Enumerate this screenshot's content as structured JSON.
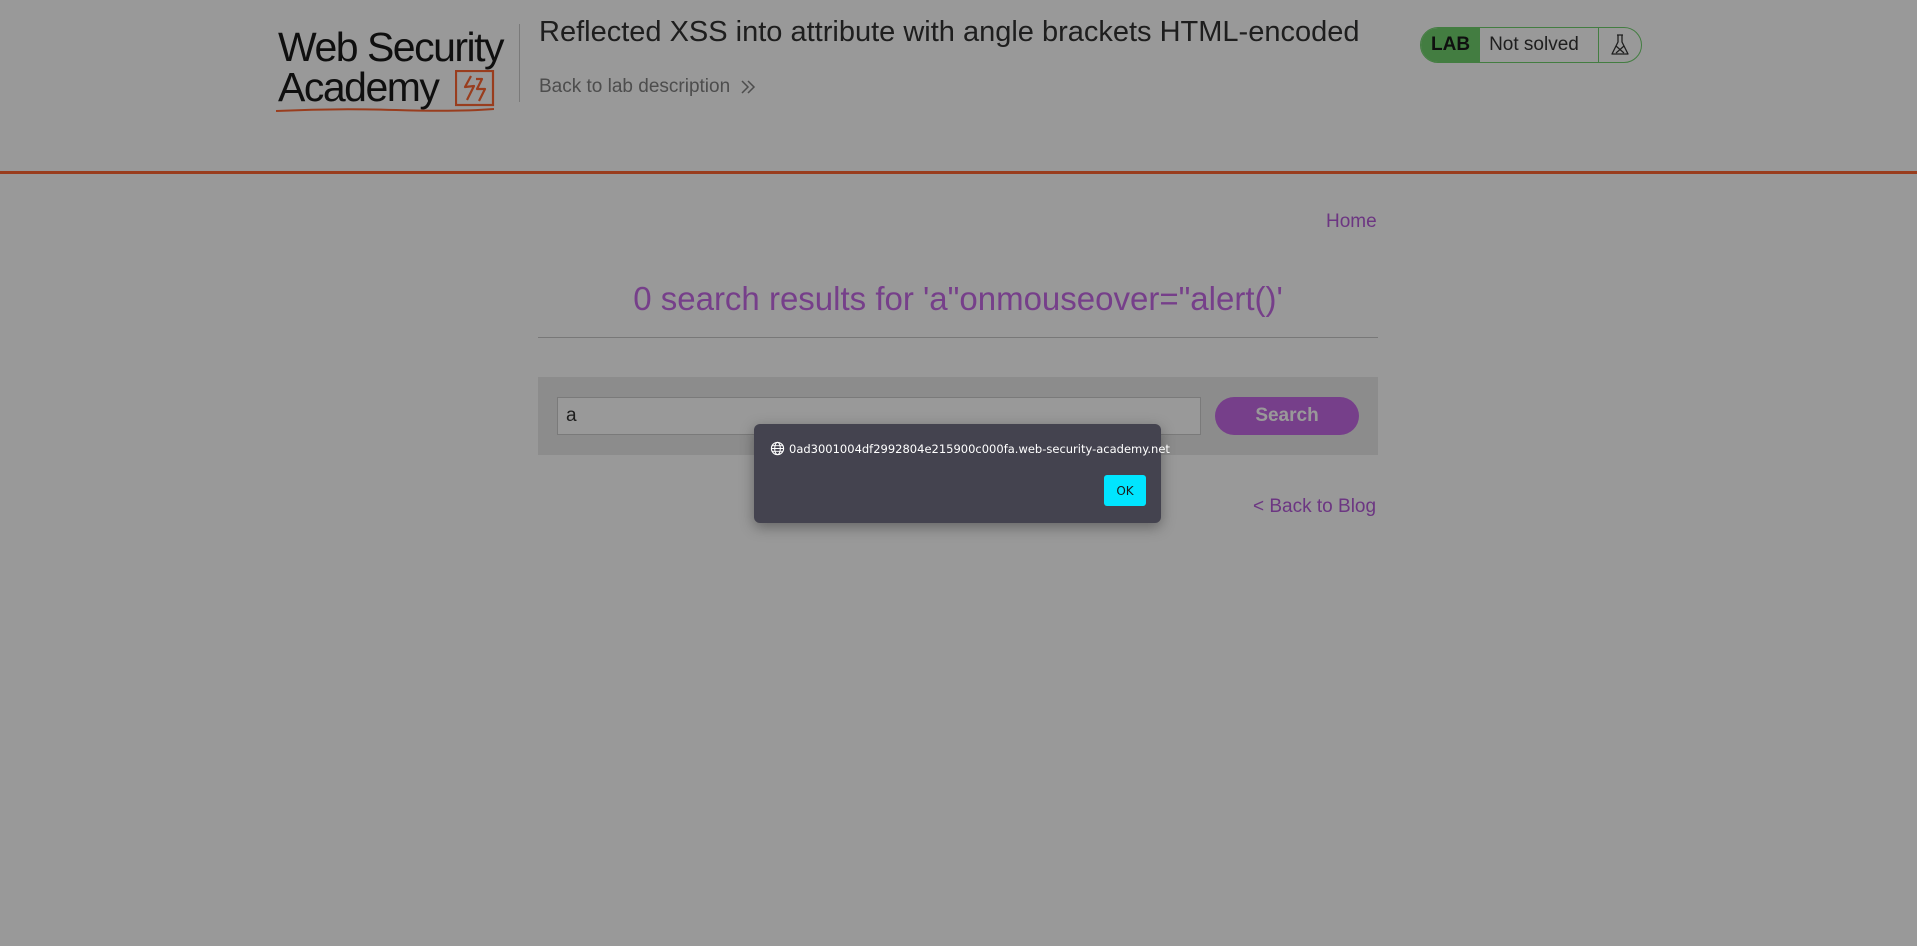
{
  "header": {
    "logo": {
      "line1": "Web Security",
      "line2": "Academy"
    },
    "lab_title": "Reflected XSS into attribute with angle brackets HTML-encoded",
    "back_to_description": "Back to lab description",
    "lab_badge": {
      "label": "LAB",
      "status": "Not solved",
      "icon": "flask-icon"
    }
  },
  "nav": {
    "home": "Home"
  },
  "results": {
    "title": "0 search results for 'a\"onmouseover=\"alert()'"
  },
  "search": {
    "value": "a",
    "button_label": "Search"
  },
  "back_to_blog": "< Back to Blog",
  "dialog": {
    "origin": "0ad3001004df2992804e215900c000fa.web-security-academy.net",
    "ok_label": "OK",
    "icon": "globe-icon"
  },
  "colors": {
    "accent": "#ff6633",
    "link": "#b55bd9",
    "button": "#c56ae6",
    "lab_green": "#70d16d",
    "dialog_bg": "#44434f",
    "ok_button": "#00e5ff"
  }
}
